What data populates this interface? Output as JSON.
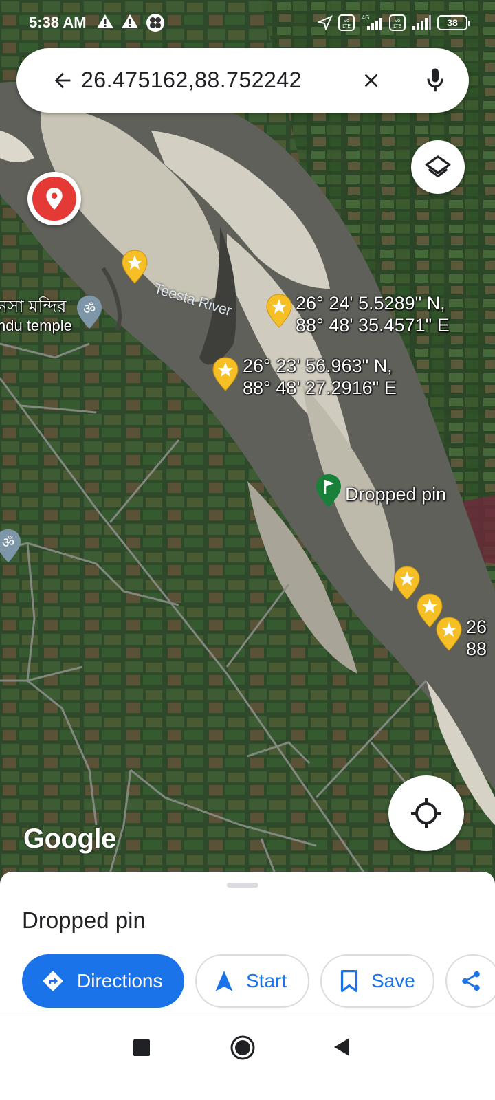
{
  "status_bar": {
    "time": "5:38 AM",
    "left_icons": [
      "warning-icon",
      "warning-icon",
      "pinwheel-icon"
    ],
    "right_icons": [
      "location-arrow-icon",
      "volte-icon",
      "signal-4g-icon",
      "volte-icon",
      "signal-icon"
    ],
    "net_label": "4G",
    "volte_label": "Vo LTE",
    "battery": "38"
  },
  "search": {
    "query": "26.475162,88.752242",
    "back_icon": "arrow-left-icon",
    "clear_icon": "close-icon",
    "mic_icon": "microphone-icon"
  },
  "map": {
    "river_label": "Teesta River",
    "temple_label_line1": "নসা মন্দির",
    "temple_label_line2": "ndu temple",
    "pins": [
      {
        "label_line1": "26° 24' 5.5289\" N,",
        "label_line2": "88° 48' 35.4571\" E"
      },
      {
        "label_line1": "26° 23' 56.963\" N,",
        "label_line2": "88° 48' 27.2916\" E"
      },
      {
        "label_line1": "26",
        "label_line2": "88"
      }
    ],
    "dropped_pin_label": "Dropped pin",
    "logo": "Google",
    "colors": {
      "water": "#5e5f58",
      "sand": "#c9c5b8",
      "field": "#2f4a2c",
      "pin_yellow": "#f6bf26",
      "pin_green": "#188038",
      "pin_red": "#e53935"
    }
  },
  "sheet": {
    "title": "Dropped pin",
    "actions": [
      {
        "label": "Directions",
        "icon": "directions-icon"
      },
      {
        "label": "Start",
        "icon": "navigation-arrow-icon"
      },
      {
        "label": "Save",
        "icon": "bookmark-icon"
      },
      {
        "label": "",
        "icon": "share-icon"
      }
    ]
  },
  "nav_bar": {
    "buttons": [
      "recents-square-icon",
      "home-circle-icon",
      "back-triangle-icon"
    ]
  },
  "accent_color": "#1a73e8"
}
